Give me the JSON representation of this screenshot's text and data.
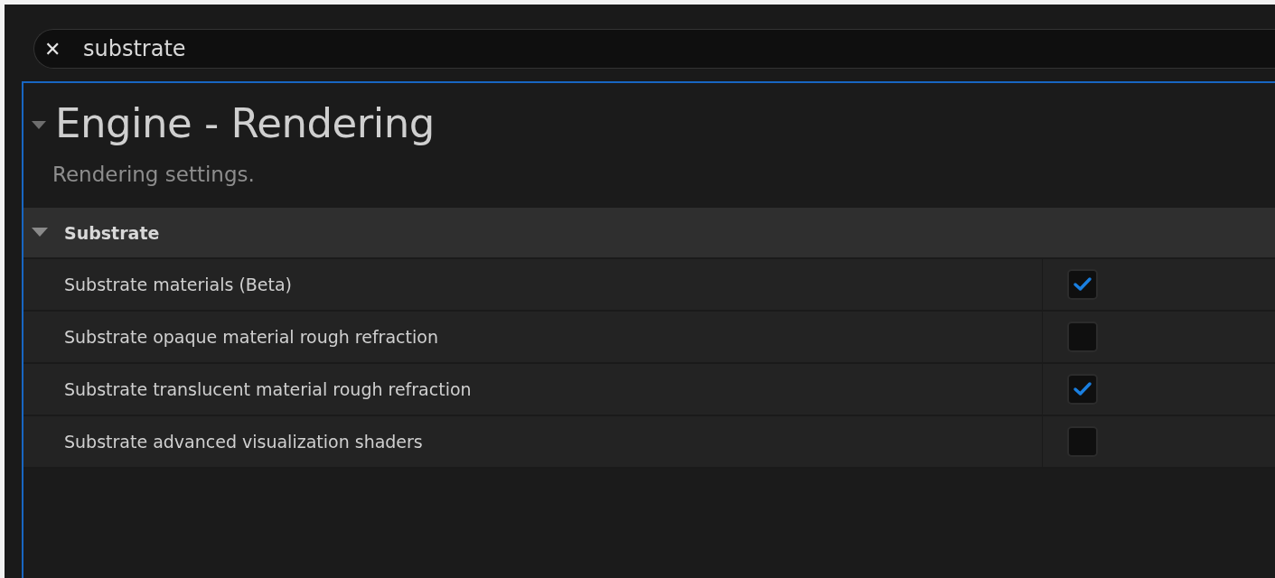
{
  "search": {
    "value": "substrate",
    "clear_icon": "✕"
  },
  "section": {
    "title": "Engine - Rendering",
    "expanded": true,
    "description": "Rendering settings."
  },
  "category": {
    "title": "Substrate",
    "expanded": true
  },
  "settings": [
    {
      "label": "Substrate materials (Beta)",
      "checked": true
    },
    {
      "label": "Substrate opaque material rough refraction",
      "checked": false
    },
    {
      "label": "Substrate translucent material rough refraction",
      "checked": true
    },
    {
      "label": "Substrate advanced visualization shaders",
      "checked": false
    }
  ]
}
